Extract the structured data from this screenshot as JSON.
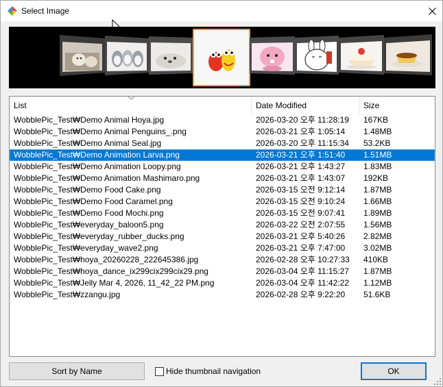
{
  "window": {
    "title": "Select Image"
  },
  "icons": {
    "app": "app-logo-icon",
    "close": "close-icon",
    "cursor": "mouse-cursor-icon",
    "sort": "sort-indicator-icon"
  },
  "colors": {
    "selection": "#0078d7",
    "thumb_highlight": "#f0a040",
    "strip_bg": "#000000"
  },
  "thumbnails": [
    {
      "label": "Demo Animal Hoya"
    },
    {
      "label": "Demo Animal Penguins_"
    },
    {
      "label": "Demo Animal Seal"
    },
    {
      "label": "Demo Animation Larva",
      "selected": true
    },
    {
      "label": "Demo Animation Loopy"
    },
    {
      "label": "Demo Animation Mashimaro"
    },
    {
      "label": "Demo Food Cake"
    },
    {
      "label": "Demo Food Caramel"
    }
  ],
  "list": {
    "columns": [
      "List",
      "Date Modified",
      "Size"
    ],
    "rows": [
      {
        "name": "WobblePic_Test₩Demo Animal Hoya.jpg",
        "date": "2026-03-20 오후 11:28:19",
        "size": "167KB"
      },
      {
        "name": "WobblePic_Test₩Demo Animal Penguins_.png",
        "date": "2026-03-21 오후 1:05:14",
        "size": "1.48MB"
      },
      {
        "name": "WobblePic_Test₩Demo Animal Seal.jpg",
        "date": "2026-03-20 오후 11:15:34",
        "size": "53.2KB"
      },
      {
        "name": "WobblePic_Test₩Demo Animation Larva.png",
        "date": "2026-03-21 오후 1:51:40",
        "size": "1.51MB",
        "selected": true
      },
      {
        "name": "WobblePic_Test₩Demo Animation Loopy.png",
        "date": "2026-03-21 오후 1:43:27",
        "size": "1.83MB"
      },
      {
        "name": "WobblePic_Test₩Demo Animation Mashimaro.png",
        "date": "2026-03-21 오후 1:43:07",
        "size": "192KB"
      },
      {
        "name": "WobblePic_Test₩Demo Food Cake.png",
        "date": "2026-03-15 오전 9:12:14",
        "size": "1.87MB"
      },
      {
        "name": "WobblePic_Test₩Demo Food Caramel.png",
        "date": "2026-03-15 오전 9:10:24",
        "size": "1.66MB"
      },
      {
        "name": "WobblePic_Test₩Demo Food Mochi.png",
        "date": "2026-03-15 오전 9:07:41",
        "size": "1.89MB"
      },
      {
        "name": "WobblePic_Test₩everyday_baloon5.png",
        "date": "2026-03-22 오전 2:07:55",
        "size": "1.56MB"
      },
      {
        "name": "WobblePic_Test₩everyday_rubber_ducks.png",
        "date": "2026-03-21 오후 5:40:26",
        "size": "2.82MB"
      },
      {
        "name": "WobblePic_Test₩everyday_wave2.png",
        "date": "2026-03-21 오후 7:47:00",
        "size": "3.02MB"
      },
      {
        "name": "WobblePic_Test₩hoya_20260228_222645386.jpg",
        "date": "2026-02-28 오후 10:27:33",
        "size": "410KB"
      },
      {
        "name": "WobblePic_Test₩hoya_dance_ix299cix299cix29.png",
        "date": "2026-03-04 오후 11:15:27",
        "size": "1.87MB"
      },
      {
        "name": "WobblePic_Test₩Jelly Mar 4, 2026, 11_42_22 PM.png",
        "date": "2026-03-04 오후 11:42:22",
        "size": "1.12MB"
      },
      {
        "name": "WobblePic_Test₩zzangu.jpg",
        "date": "2026-02-28 오후 9:22:20",
        "size": "51.6KB"
      }
    ]
  },
  "buttons": {
    "sort": "Sort by Name",
    "ok": "OK"
  },
  "checkbox": {
    "label": "Hide thumbnail navigation",
    "checked": false
  }
}
